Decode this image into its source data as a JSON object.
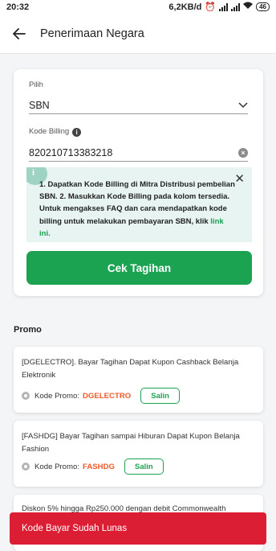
{
  "status": {
    "time": "20:32",
    "net": "6,2KB/d",
    "battery": "46"
  },
  "header": {
    "title": "Penerimaan Negara"
  },
  "form": {
    "pilih_label": "Pilih",
    "pilih_value": "SBN",
    "billing_label": "Kode Billing",
    "billing_value": "820210713383218",
    "notice_text": "1. Dapatkan Kode Billing di Mitra Distribusi pembelian SBN. 2. Masukkan Kode Billing pada kolom tersedia. Untuk mengakses FAQ dan cara mendapatkan kode billing untuk melakukan pembayaran SBN, klik ",
    "notice_link": "link ini.",
    "button": "Cek Tagihan"
  },
  "promo": {
    "title": "Promo",
    "code_label": "Kode Promo:",
    "copy_label": "Salin",
    "items": [
      {
        "desc": "[DGELECTRO]. Bayar Tagihan Dapat Kupon Cashback Belanja Elektronik",
        "code": "DGELECTRO"
      },
      {
        "desc": "[FASHDG] Bayar Tagihan sampai Hiburan Dapat Kupon Belanja Fashion",
        "code": "FASHDG"
      },
      {
        "desc": "Diskon 5% hingga Rp250.000 dengan debit Commonwealth"
      }
    ]
  },
  "toast": "Kode Bayar Sudah Lunas",
  "colors": {
    "primary": "#1ca352",
    "promo_code": "#f05a28",
    "toast": "#dc1e35"
  }
}
